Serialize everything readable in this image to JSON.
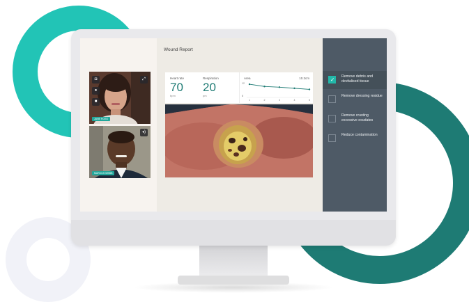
{
  "window": {
    "title": "Wound Report"
  },
  "participants": [
    {
      "name": "JANE ROSS"
    },
    {
      "name": "MARCUS WEBB"
    }
  ],
  "video_controls": [
    {
      "icon": "camera-icon",
      "glyph": "◘"
    },
    {
      "icon": "microphone-icon",
      "glyph": "●"
    },
    {
      "icon": "video-icon",
      "glyph": "■"
    },
    {
      "icon": "expand-icon",
      "glyph": "⤢"
    },
    {
      "icon": "speaker-icon",
      "glyph": "◂)"
    }
  ],
  "vitals": {
    "heart_rate": {
      "label": "Heart rate",
      "value": "70",
      "unit": "bpm"
    },
    "respiration": {
      "label": "Respiration",
      "value": "20",
      "unit": "pm"
    },
    "area": {
      "label": "Area",
      "value": "10.2cm"
    }
  },
  "area_chart": {
    "y_top_tick": "12",
    "y_bottom_tick": "8",
    "x_ticks": [
      "1",
      "2",
      "3",
      "4",
      "5"
    ],
    "values": [
      11.6,
      11.0,
      10.8,
      10.5,
      10.2
    ],
    "ylim": [
      8,
      12
    ]
  },
  "tasks": [
    {
      "label": "Remove debris and devitalised tissue",
      "checked": true
    },
    {
      "label": "Remove dressing residue",
      "checked": false
    },
    {
      "label": "Remove crusting excessive exudates",
      "checked": false
    },
    {
      "label": "Reduce contamination",
      "checked": false
    }
  ],
  "colors": {
    "accent": "#22c4b6",
    "accent_dark": "#1e7b74",
    "sidebar": "#4e5a66",
    "alert": "#e8514f"
  }
}
